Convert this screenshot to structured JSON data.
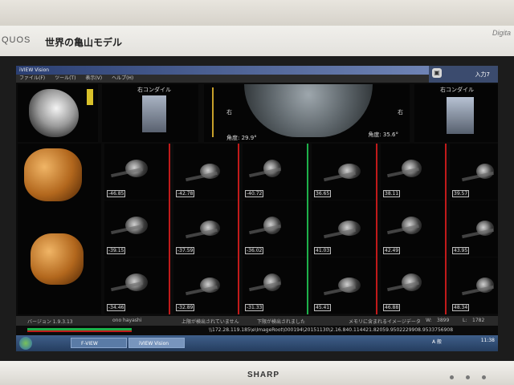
{
  "monitor": {
    "brand_left": "QUOS",
    "brand_right": "Digita",
    "sticker": "世界の亀山モデル",
    "maker": "SHARP"
  },
  "app": {
    "title": "iVIEW Vision",
    "menus": [
      "ファイル(F)",
      "ツール(T)",
      "表示(V)",
      "ヘルプ(H)"
    ],
    "panel_label": "入力7",
    "panel_icon": "document-icon"
  },
  "top_views": {
    "right_condyle_left": "右コンダイル",
    "right_condyle_right": "右コンダイル",
    "angle_left": "角度: 29.9°",
    "angle_right": "角度: 35.6°",
    "marker_right": "右"
  },
  "slices": [
    "-46.85",
    "-42.78",
    "-40.72",
    "36.65",
    "38.11",
    "39.57",
    "-39.15",
    "-37.59",
    "-36.02",
    "41.03",
    "42.49",
    "43.95",
    "-34.46",
    "-32.89",
    "-31.33",
    "45.41",
    "46.88",
    "48.34"
  ],
  "status": {
    "version": "バージョン 1.9.3.13",
    "user": "ono hayashi",
    "detect_left": "上限が検出されていません",
    "detect_lower": "下限が検出されました",
    "memory": "メモリに含まれるイメージデータ",
    "w_label": "W:",
    "w_value": "3899",
    "l_label": "L:",
    "l_value": "1782",
    "path": "\\\\172.28.119.185\\e\\ImageRoot\\000194\\20151130\\2.16.840.114421.82059.9502229908.9533756908"
  },
  "taskbar": {
    "tasks": [
      "F-VIEW",
      "iVIEW Vision"
    ],
    "time": "11:38",
    "lang": "A 般"
  },
  "colors": {
    "accent_red": "#c11a1a",
    "accent_green": "#1db04a",
    "title_blue": "#2b3f72"
  }
}
